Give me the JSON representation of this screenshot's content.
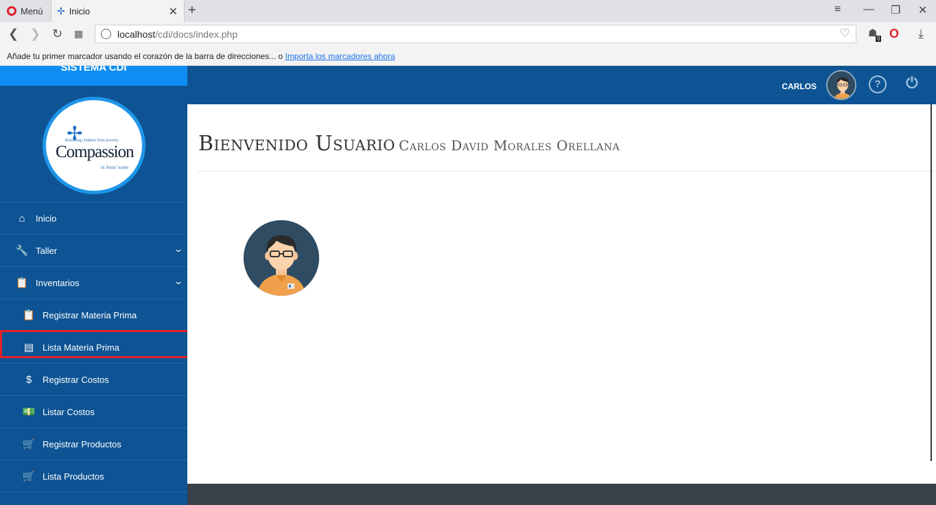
{
  "browser": {
    "menu_label": "Menú",
    "tab_title": "Inicio",
    "url_host": "localhost",
    "url_path": "/cdi/docs/index.php",
    "bookmark_hint": "Añade tu primer marcador usando el corazón de la barra de direcciones... o",
    "bookmark_link": "Importa los marcadores ahora",
    "download_badge": "0"
  },
  "sidebar": {
    "brand": "SISTEMA CDI",
    "logo_text": "Compassion",
    "logo_tagline": "Releasing children from poverty",
    "logo_sub": "in Jesus' name",
    "items": [
      {
        "label": "Inicio",
        "icon": "home-icon"
      },
      {
        "label": "Taller",
        "icon": "wrench-icon"
      },
      {
        "label": "Inventarios",
        "icon": "clipboard-icon"
      },
      {
        "label": "Registrar Materia Prima",
        "icon": "clipboard-icon"
      },
      {
        "label": "Lista Materia Prima",
        "icon": "clipboard-list-icon"
      },
      {
        "label": "Registrar Costos",
        "icon": "dollar-icon"
      },
      {
        "label": "Listar Costos",
        "icon": "money-icon"
      },
      {
        "label": "Registrar Productos",
        "icon": "cart-icon"
      },
      {
        "label": "Lista Productos",
        "icon": "cart-icon"
      }
    ]
  },
  "topbar": {
    "user": "CARLOS",
    "help_icon": "help-icon",
    "power_icon": "power-icon"
  },
  "main": {
    "welcome": "Bienvenido Usuario",
    "full_name": "Carlos David Morales Orellana"
  },
  "colors": {
    "sidebar": "#0e5494",
    "brand": "#0e8ef2",
    "highlight": "#e8202a"
  }
}
